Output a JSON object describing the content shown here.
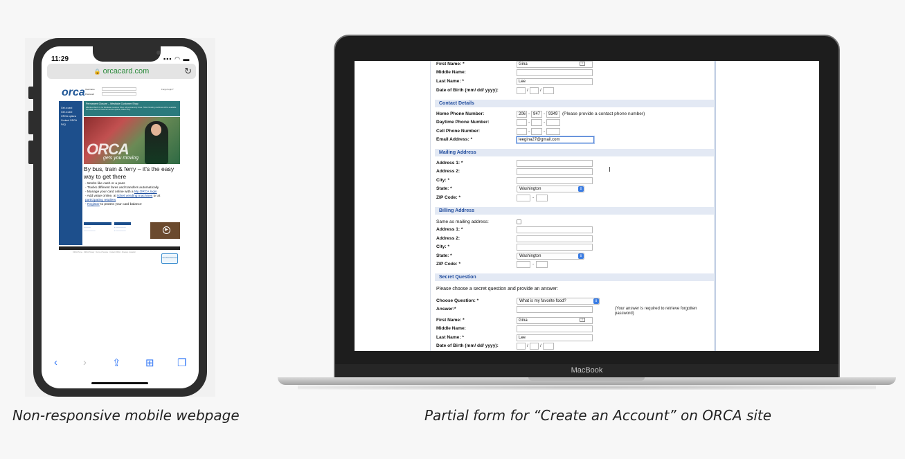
{
  "phone": {
    "time": "11:29",
    "status_icons": "▪▪▪ ◠ ▬",
    "url": "orcacard.com",
    "site": {
      "logo": "orca",
      "username_label": "Username",
      "password_label": "Password",
      "forgot": "Forgot login?",
      "nav_items": [
        "Get a card",
        "Get a card",
        "ORCA options",
        "Contact ORCA",
        "FAQ"
      ],
      "closure_title": "Permanent Closure – Westlake Customer Shop",
      "closure_text": "Effective March 6, the Westlake Customer Shop will permanently close. Ticket Vending machines will be available. For other sales or customer service options, select FAQ.",
      "hero_word": "ORCA",
      "hero_tag": "gets you moving",
      "headline": "By bus, train & ferry – it's the easy way to get there",
      "bullets": [
        {
          "pre": "- Works like cash or a pass",
          "link": "",
          "post": ""
        },
        {
          "pre": "- Tracks different fares and transfers automatically",
          "link": "",
          "post": ""
        },
        {
          "pre": "- Manage your card online with a ",
          "link": "My ORCA login",
          "post": ""
        },
        {
          "pre": "- Add value online, at ",
          "link": "ticket vending machines",
          "post": " or at"
        },
        {
          "pre": "  ",
          "link": "participating retailers",
          "post": ""
        },
        {
          "pre": "- ",
          "link": "Register",
          "post": " to protect your card balance"
        }
      ],
      "footer_text": "ORCA Home · ORCA Privacy · Terms of Service · Contact ORCA · Sitemap · Español",
      "badge": "GeoTrust Secured"
    }
  },
  "captions": {
    "left": "Non-responsive mobile webpage",
    "right": "Partial form for “Create an Account” on ORCA site"
  },
  "laptop": {
    "brand": "MacBook",
    "form": {
      "first_name_label": "First Name: *",
      "first_name_value": "Gina",
      "middle_name_label": "Middle Name:",
      "last_name_label": "Last Name: *",
      "last_name_value": "Lee",
      "dob_label": "Date of Birth (mm/ dd/ yyyy):",
      "contact_head": "Contact Details",
      "home_phone_label": "Home Phone Number:",
      "home_phone": [
        "206",
        "947",
        "9349"
      ],
      "home_phone_note": "(Please provide a contact phone number)",
      "day_phone_label": "Daytime Phone Number:",
      "cell_phone_label": "Cell Phone Number:",
      "email_label": "Email Address: *",
      "email_value": "leegina27@gmail.com",
      "mailing_head": "Mailing Address",
      "address1_label": "Address 1: *",
      "address2_label": "Address 2:",
      "city_label": "City: *",
      "state_label": "State: *",
      "state_value": "Washington",
      "zip_label": "ZIP Code: *",
      "billing_head": "Billing Address",
      "same_as_label": "Same as mailing address:",
      "secret_head": "Secret Question",
      "secret_intro": "Please choose a secret question and provide an answer:",
      "choose_q_label": "Choose Question: *",
      "choose_q_value": "What is my favorite food?",
      "answer_label": "Answer:*",
      "answer_note": "(Your answer is required to retrieve forgotten password)"
    }
  }
}
